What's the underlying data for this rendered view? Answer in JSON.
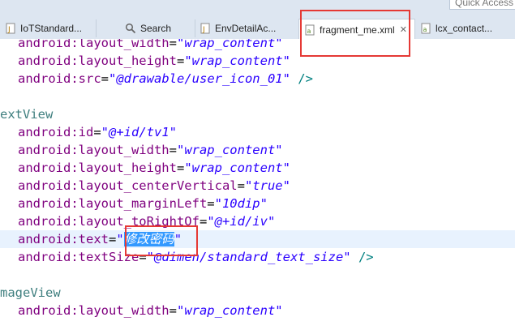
{
  "quick_access": {
    "label": "Quick Access"
  },
  "tabs": [
    {
      "label": "IoTStandard...",
      "icon": "java-file-icon",
      "active": false
    },
    {
      "label": "Search",
      "icon": "search-icon",
      "active": false
    },
    {
      "label": "EnvDetailAc...",
      "icon": "java-file-icon",
      "active": false
    },
    {
      "label": "fragment_me.xml",
      "icon": "xml-file-icon",
      "active": true,
      "close": "✕"
    },
    {
      "label": "lcx_contact...",
      "icon": "xml-file-icon",
      "active": false
    }
  ],
  "code": {
    "l0": {
      "attr": "android:layout_width",
      "eq": "=",
      "str": "\"wrap_content\""
    },
    "l1": {
      "attr": "android:layout_height",
      "eq": "=",
      "str": "\"wrap_content\""
    },
    "l2": {
      "attr": "android:src",
      "eq": "=",
      "str": "\"@drawable/user_icon_01\"",
      "end": " />"
    },
    "l4": {
      "tag": "extView"
    },
    "l5": {
      "attr": "android:id",
      "eq": "=",
      "str": "\"@+id/tv1\""
    },
    "l6": {
      "attr": "android:layout_width",
      "eq": "=",
      "str": "\"wrap_content\""
    },
    "l7": {
      "attr": "android:layout_height",
      "eq": "=",
      "str": "\"wrap_content\""
    },
    "l8": {
      "attr": "android:layout_centerVertical",
      "eq": "=",
      "str": "\"true\""
    },
    "l9": {
      "attr": "android:layout_marginLeft",
      "eq": "=",
      "str": "\"10dip\""
    },
    "l10": {
      "attr": "android:layout_toRightOf",
      "eq": "=",
      "str": "\"@+id/iv\""
    },
    "l11": {
      "attr": "android:text",
      "eq": "=",
      "q1": "\"",
      "sel": "修改密码",
      "q2": "\""
    },
    "l12": {
      "attr": "android:textSize",
      "eq": "=",
      "str": "\"@dimen/standard_text_size\"",
      "end": " />"
    },
    "l14": {
      "tag": "mageView"
    },
    "l15": {
      "attr": "android:layout_width",
      "eq": "=",
      "str": "\"wrap_content\""
    }
  },
  "colors": {
    "tag": "#3f7f7f",
    "attr": "#7f007f",
    "string": "#2a00ff",
    "selection": "#3399ff",
    "current_line": "#e8f2fe",
    "highlight_box": "#e53935"
  }
}
